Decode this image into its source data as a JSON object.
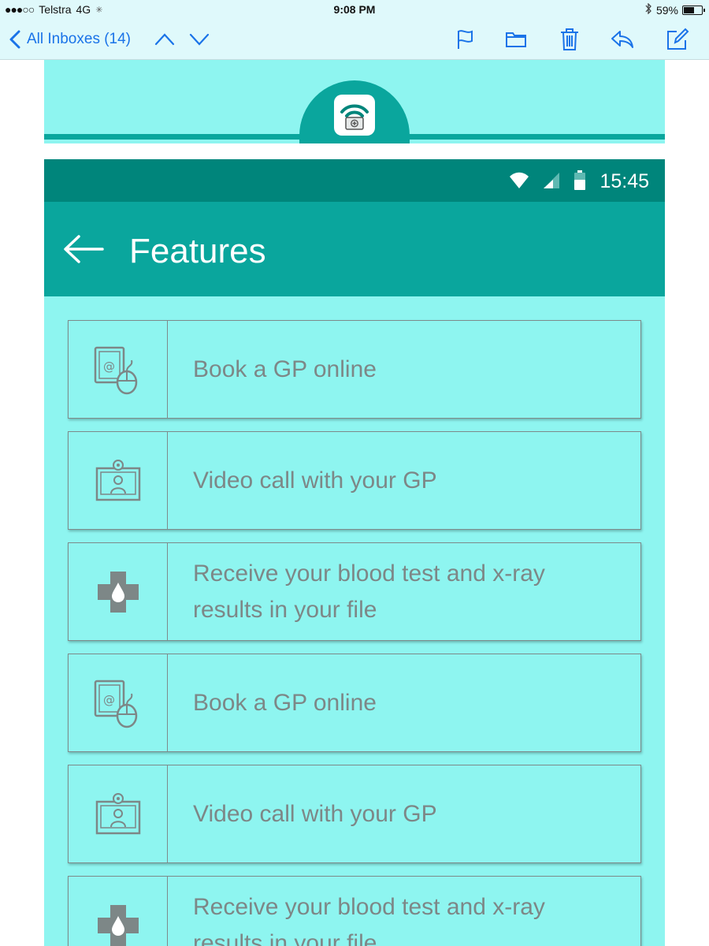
{
  "ios_status": {
    "carrier": "Telstra",
    "network": "4G",
    "time": "9:08 PM",
    "battery": "59%"
  },
  "mail": {
    "back_label": "All Inboxes (14)",
    "icons": [
      "flag-icon",
      "folder-icon",
      "trash-icon",
      "reply-icon",
      "compose-icon"
    ]
  },
  "phone_status": {
    "time": "15:45"
  },
  "appbar": {
    "title": "Features"
  },
  "features": [
    {
      "label": "Book a GP online",
      "icon": "book-online-icon"
    },
    {
      "label": "Video call with your GP",
      "icon": "video-call-icon"
    },
    {
      "label": "Receive your blood test and x-ray results in your file",
      "icon": "medical-cross-icon"
    },
    {
      "label": "Book a GP online",
      "icon": "book-online-icon"
    },
    {
      "label": "Video call with your GP",
      "icon": "video-call-icon"
    },
    {
      "label": "Receive your blood test and x-ray results in your file",
      "icon": "medical-cross-icon"
    }
  ],
  "colors": {
    "teal_dark": "#00857b",
    "teal": "#0aa69d",
    "aqua": "#8ef5f0",
    "ios_blue": "#1a73e8"
  }
}
